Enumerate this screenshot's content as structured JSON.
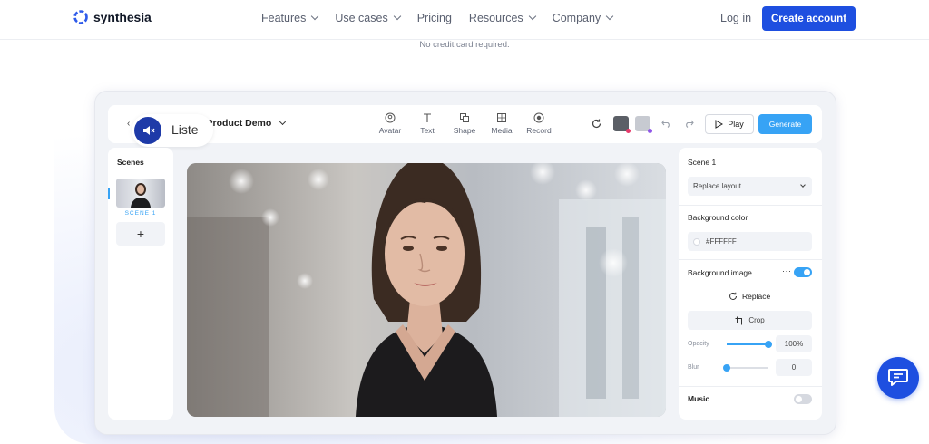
{
  "brand": {
    "name": "synthesia",
    "accent": "#1e4fe0"
  },
  "nav": {
    "links": [
      {
        "label": "Features",
        "dropdown": true
      },
      {
        "label": "Use cases",
        "dropdown": true
      },
      {
        "label": "Pricing",
        "dropdown": false
      },
      {
        "label": "Resources",
        "dropdown": true
      },
      {
        "label": "Company",
        "dropdown": true
      }
    ],
    "login": "Log in",
    "cta": "Create account"
  },
  "hero": {
    "note": "No credit card required."
  },
  "editor": {
    "project_title": "Synthesia Product Demo",
    "listen_label": "Liste",
    "tools": [
      {
        "label": "Avatar",
        "icon": "avatar-icon"
      },
      {
        "label": "Text",
        "icon": "text-icon"
      },
      {
        "label": "Shape",
        "icon": "shape-icon"
      },
      {
        "label": "Media",
        "icon": "media-icon"
      },
      {
        "label": "Record",
        "icon": "record-icon"
      }
    ],
    "play_label": "Play",
    "generate_label": "Generate",
    "scenes": {
      "title": "Scenes",
      "items": [
        {
          "label": "SCENE 1"
        }
      ],
      "add_label": "+"
    },
    "panel": {
      "scene_title": "Scene 1",
      "layout_select": "Replace layout",
      "bg_color_label": "Background color",
      "bg_color_value": "#FFFFFF",
      "bg_image_label": "Background image",
      "bg_image_enabled": true,
      "replace_label": "Replace",
      "crop_label": "Crop",
      "opacity_label": "Opacity",
      "opacity_value": "100%",
      "opacity_fraction": 1.0,
      "blur_label": "Blur",
      "blur_value": "0",
      "blur_fraction": 0.0,
      "music_label": "Music",
      "music_enabled": false
    }
  }
}
